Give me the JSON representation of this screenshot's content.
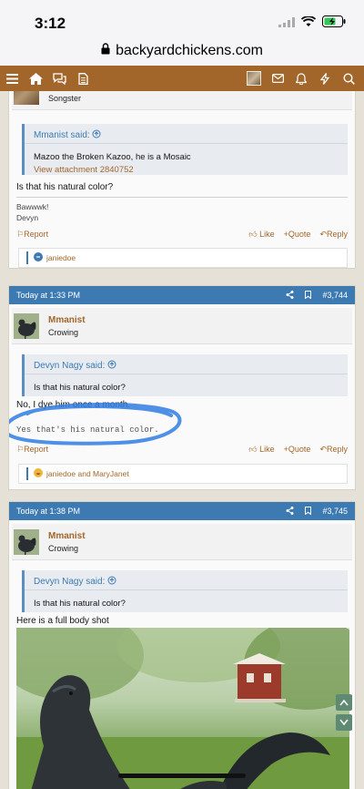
{
  "status": {
    "time": "3:12"
  },
  "browser": {
    "url": "backyardchickens.com"
  },
  "top_partial": {
    "usertitle": "Songster"
  },
  "post1": {
    "quote_author": "Mmanist said:",
    "quote_text": "Mazoo the Broken Kazoo, he is a Mosaic",
    "quote_link": "View attachment 2840752",
    "message": "Is that his natural color?",
    "sig_line1": "Bawwwk!",
    "sig_line2": "Devyn",
    "report": "Report",
    "like": "Like",
    "quote": "Quote",
    "reply": "Reply",
    "reactions": "janiedoe"
  },
  "post2": {
    "time": "Today at 1:33 PM",
    "number": "#3,744",
    "username": "Mmanist",
    "usertitle": "Crowing",
    "quote_author": "Devyn Nagy said:",
    "quote_text": "Is that his natural color?",
    "message": "No, I dye him once a month.",
    "sig": "Yes that's his natural color.",
    "report": "Report",
    "like": "Like",
    "quote": "Quote",
    "reply": "Reply",
    "reactions": "janiedoe and MaryJanet"
  },
  "post3": {
    "time": "Today at 1:38 PM",
    "number": "#3,745",
    "username": "Mmanist",
    "usertitle": "Crowing",
    "quote_author": "Devyn Nagy said:",
    "quote_text": "Is that his natural color?",
    "message": "Here is a full body shot"
  },
  "colors": {
    "brand": "#a3662a",
    "header": "#3d7ab1",
    "scribble": "#2f7de0"
  }
}
